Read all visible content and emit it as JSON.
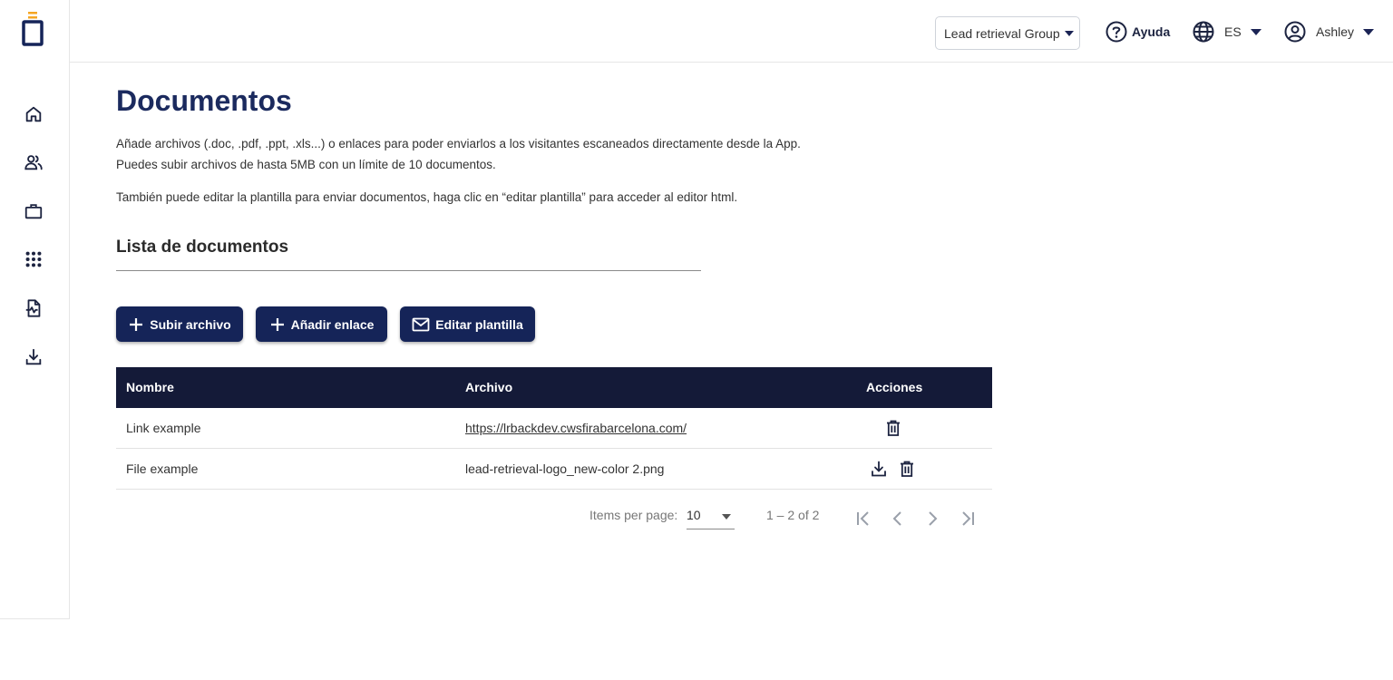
{
  "header": {
    "group_label": "Lead retrieval Group",
    "help_label": "Ayuda",
    "lang_label": "ES",
    "user_label": "Ashley"
  },
  "sidebar": {
    "items": [
      {
        "icon": "home-icon"
      },
      {
        "icon": "users-icon"
      },
      {
        "icon": "briefcase-icon"
      },
      {
        "icon": "apps-grid-icon"
      },
      {
        "icon": "document-icon"
      },
      {
        "icon": "download-icon"
      }
    ]
  },
  "main": {
    "title": "Documentos",
    "desc1": "Añade archivos (.doc, .pdf, .ppt, .xls...) o enlaces para poder enviarlos a los visitantes escaneados directamente desde la App.",
    "desc2": "Puedes subir archivos de hasta 5MB con un límite de 10 documentos.",
    "desc3": "También puede editar la plantilla para enviar documentos, haga clic en “editar plantilla” para acceder al editor html.",
    "section_title": "Lista de documentos",
    "buttons": {
      "upload": "Subir archivo",
      "add_link": "Añadir enlace",
      "edit_template": "Editar plantilla"
    }
  },
  "table": {
    "headers": [
      "Nombre",
      "Archivo",
      "Acciones"
    ],
    "rows": [
      {
        "name": "Link example",
        "file": "https://lrbackdev.cwsfirabarcelona.com/"
      },
      {
        "name": "File example",
        "file": "lead-retrieval-logo_new-color 2.png"
      }
    ]
  },
  "paginator": {
    "items_per_page_label": "Items per page:",
    "page_size": "10",
    "range": "1 – 2 of 2"
  },
  "colors": {
    "primary": "#152458",
    "table_header": "#141a38",
    "logo_accent": "#f5a623"
  }
}
